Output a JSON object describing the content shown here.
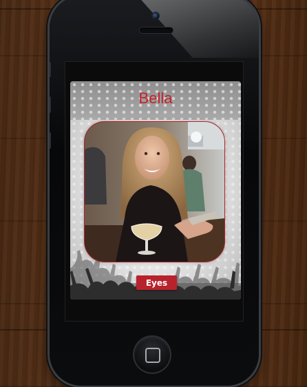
{
  "profile": {
    "name": "Bella",
    "photo_alt": "",
    "action_button_label": "Eyes"
  },
  "colors": {
    "accent": "#c4212b",
    "button_bg": "#b8222c",
    "button_text": "#ffffff"
  },
  "icons": {
    "home": "home-button-icon",
    "camera": "front-camera-icon",
    "speaker": "earpiece-speaker-icon"
  }
}
